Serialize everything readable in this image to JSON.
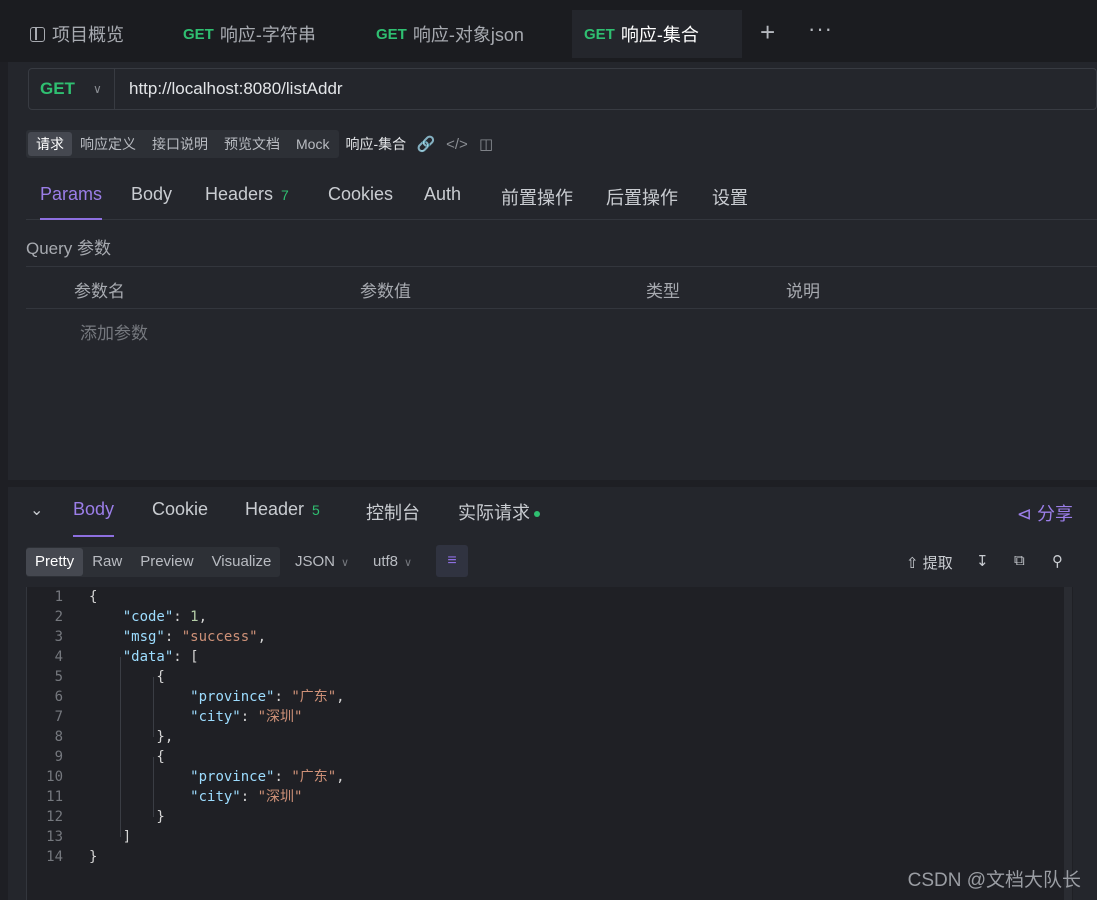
{
  "tabs": {
    "overview": "项目概览",
    "items": [
      {
        "method": "GET",
        "label": "响应-字符串"
      },
      {
        "method": "GET",
        "label": "响应-对象json"
      },
      {
        "method": "GET",
        "label": "响应-集合"
      }
    ],
    "add": "+",
    "more": "···"
  },
  "request": {
    "method": "GET",
    "url": "http://localhost:8080/listAddr",
    "modes": [
      "请求",
      "响应定义",
      "接口说明",
      "预览文档",
      "Mock"
    ],
    "active_mode": "请求",
    "name": "响应-集合",
    "tabs": [
      {
        "label": "Params"
      },
      {
        "label": "Body"
      },
      {
        "label": "Headers",
        "count": "7"
      },
      {
        "label": "Cookies"
      },
      {
        "label": "Auth"
      },
      {
        "label": "前置操作"
      },
      {
        "label": "后置操作"
      },
      {
        "label": "设置"
      }
    ],
    "query_label": "Query 参数",
    "columns": [
      "参数名",
      "参数值",
      "类型",
      "说明"
    ],
    "add_param": "添加参数"
  },
  "response": {
    "tabs": [
      {
        "label": "Body"
      },
      {
        "label": "Cookie"
      },
      {
        "label": "Header",
        "count": "5"
      },
      {
        "label": "控制台"
      },
      {
        "label": "实际请求"
      }
    ],
    "share": "分享",
    "views": [
      "Pretty",
      "Raw",
      "Preview",
      "Visualize"
    ],
    "active_view": "Pretty",
    "format": "JSON",
    "encoding": "utf8",
    "extract": "提取",
    "code_lines": [
      "{",
      "    \"code\": 1,",
      "    \"msg\": \"success\",",
      "    \"data\": [",
      "        {",
      "            \"province\": \"广东\",",
      "            \"city\": \"深圳\"",
      "        },",
      "        {",
      "            \"province\": \"广东\",",
      "            \"city\": \"深圳\"",
      "        }",
      "    ]",
      "}"
    ]
  },
  "watermark": "CSDN @文档大队长",
  "colors": {
    "accent": "#8d6fe0",
    "method_get": "#2fbf71",
    "json_key": "#9cdcfe",
    "json_string": "#ce9178",
    "json_number": "#b5cea8"
  }
}
